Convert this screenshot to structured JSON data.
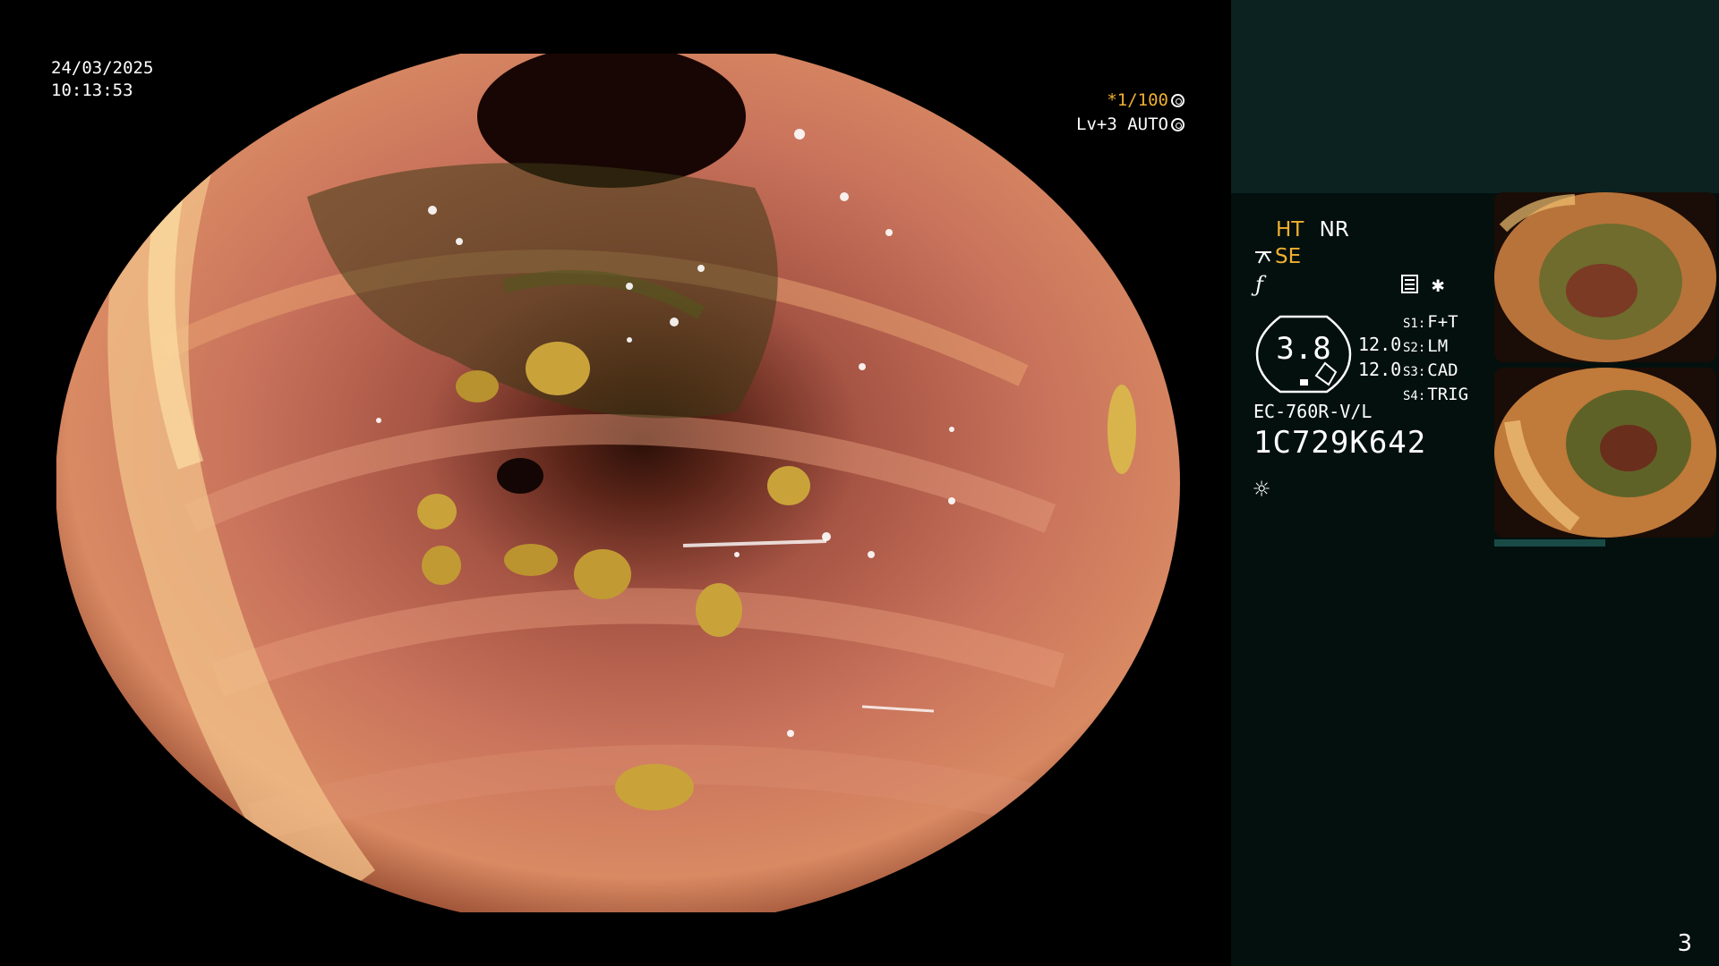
{
  "overlay": {
    "date": "24/03/2025",
    "time": "10:13:53",
    "shutter": "*1/100",
    "brightness": "Lv+3 AUTO"
  },
  "modes": {
    "ht": "HT",
    "nr": "NR",
    "se": "SE"
  },
  "gauge": {
    "value": "3.8",
    "num_top": "12.0",
    "num_bottom": "12.0"
  },
  "switches": [
    {
      "key": "S1:",
      "value": "F+T"
    },
    {
      "key": "S2:",
      "value": "LM"
    },
    {
      "key": "S3:",
      "value": "CAD"
    },
    {
      "key": "S4:",
      "value": "TRIG"
    }
  ],
  "scope": {
    "model": "EC-760R-V/L",
    "serial": "1C729K642"
  },
  "icons": [
    "aperture-icon",
    "auto-iris-icon",
    "scissors-icon",
    "f-icon",
    "memo-icon",
    "star-icon",
    "light-icon"
  ],
  "colors": {
    "accent": "#f0b030",
    "panel": "#03100e",
    "panel_top": "#0b2220",
    "mucosa": "#c06a55"
  },
  "page_number": "3"
}
